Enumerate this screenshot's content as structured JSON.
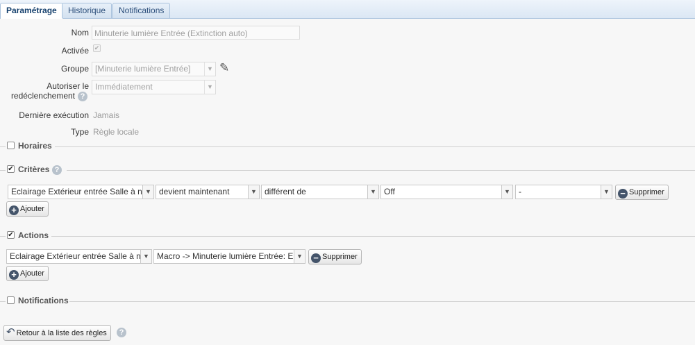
{
  "tabs": [
    {
      "label": "Paramétrage",
      "active": true
    },
    {
      "label": "Historique",
      "active": false
    },
    {
      "label": "Notifications",
      "active": false
    }
  ],
  "form": {
    "nom_label": "Nom",
    "nom_value": "Minuterie lumière Entrée (Extinction auto)",
    "activee_label": "Activée",
    "activee_checked": true,
    "groupe_label": "Groupe",
    "groupe_value": "[Minuterie lumière Entrée]",
    "autoriser_label_1": "Autoriser le",
    "autoriser_label_2": "redéclenchement",
    "autoriser_value": "Immédiatement",
    "derniere_label": "Dernière exécution",
    "derniere_value": "Jamais",
    "type_label": "Type",
    "type_value": "Règle locale"
  },
  "sections": {
    "horaires": {
      "title": "Horaires",
      "checked": false
    },
    "criteres": {
      "title": "Critères",
      "checked": true
    },
    "actions": {
      "title": "Actions",
      "checked": true
    },
    "notifications": {
      "title": "Notifications",
      "checked": false
    }
  },
  "criteria_row": {
    "device": "Eclairage Extérieur entrée Salle à n",
    "event": "devient maintenant",
    "operator": "différent de",
    "value": "Off",
    "extra": "-",
    "remove_label": "Supprimer",
    "add_label": "Ajouter"
  },
  "actions_row": {
    "device": "Eclairage Extérieur entrée Salle à n",
    "action": "Macro -> Minuterie lumière Entrée: E",
    "remove_label": "Supprimer",
    "add_label": "Ajouter"
  },
  "footer": {
    "back_label": "Retour à la liste des règles"
  },
  "icons": {
    "help": "question-icon",
    "edit": "pencil-icon",
    "minus": "minus-circle-icon",
    "plus": "plus-circle-icon",
    "back": "back-arrow-icon"
  },
  "glyphs": {
    "check": "✔",
    "arrow": "▼",
    "minus": "−",
    "plus": "+",
    "help": "?",
    "pencil": "✎",
    "back": "↶"
  }
}
